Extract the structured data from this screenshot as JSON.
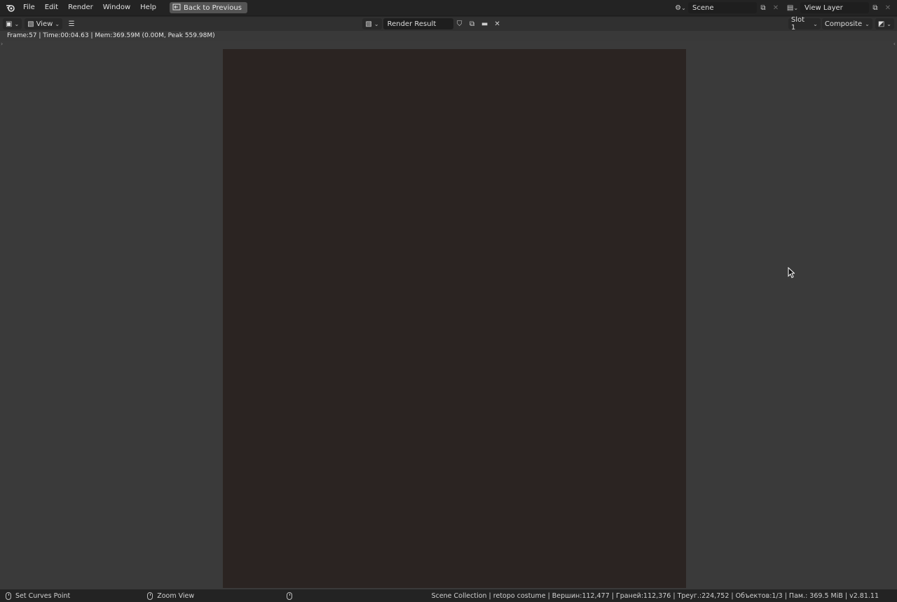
{
  "topbar": {
    "menu": [
      "File",
      "Edit",
      "Render",
      "Window",
      "Help"
    ],
    "back_label": "Back to Previous",
    "scene_name": "Scene",
    "view_layer_name": "View Layer"
  },
  "header": {
    "view_menu": "View",
    "image_name": "Render Result",
    "slot": "Slot 1",
    "pass": "Composite"
  },
  "info": {
    "text": "Frame:57 | Time:00:04.63 | Mem:369.59M (0.00M, Peak 559.98M)"
  },
  "canvas": {
    "background_color": "#3a3a3a"
  },
  "statusbar": {
    "left_action": "Set Curves Point",
    "middle_action": "Zoom View",
    "stats": "Scene Collection | retopo costume | Вершин:112,477 | Граней:112,376 | Треуг.:224,752 | Объектов:1/3 | Пам.: 369.5 MiB | v2.81.11"
  },
  "icons": [
    "blender-logo-icon",
    "back-icon",
    "scene-icon",
    "copy-icon",
    "close-icon",
    "view-layer-icon",
    "editor-type-icon",
    "image-icon",
    "hamburger-icon",
    "shield-icon",
    "folder-icon",
    "display-icon",
    "mouse-icon",
    "cursor-icon"
  ]
}
